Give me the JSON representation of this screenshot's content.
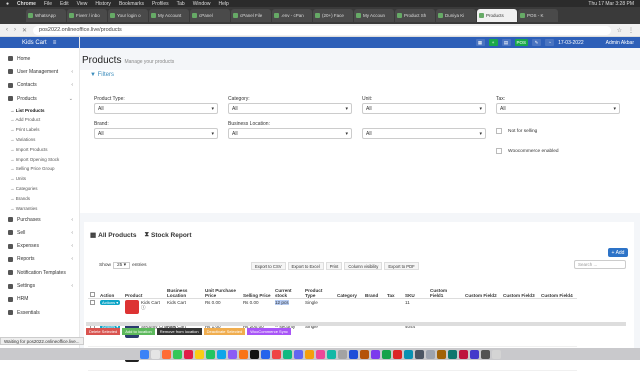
{
  "macos_menu": {
    "apple": "",
    "items": [
      "Chrome",
      "File",
      "Edit",
      "View",
      "History",
      "Bookmarks",
      "Profiles",
      "Tab",
      "Window",
      "Help"
    ],
    "clock": "Thu 17 Mar 3:28 PM"
  },
  "browser": {
    "tabs": [
      {
        "label": "WhatsApp",
        "active": false
      },
      {
        "label": "Fiverr / inbo",
        "active": false
      },
      {
        "label": "Your login o",
        "active": false
      },
      {
        "label": "My Account",
        "active": false
      },
      {
        "label": "cPanel",
        "active": false
      },
      {
        "label": "cPanel File",
        "active": false
      },
      {
        "label": ".env - cPan",
        "active": false
      },
      {
        "label": "(20+) Face",
        "active": false
      },
      {
        "label": "My Accoun",
        "active": false
      },
      {
        "label": "Product Sh",
        "active": false
      },
      {
        "label": "Duniya Ki",
        "active": false
      },
      {
        "label": "Products",
        "active": true
      },
      {
        "label": "POS - K",
        "active": false
      }
    ],
    "url": "pos2022.onlineoffice.live/products"
  },
  "app": {
    "brand": "Kids Cart",
    "topbar": {
      "pos_label": "POS",
      "date": "17-03-2022",
      "user": "Admin Akbar"
    }
  },
  "sidebar": {
    "items": [
      {
        "label": "Home",
        "chevron": ""
      },
      {
        "label": "User Management",
        "chevron": "‹"
      },
      {
        "label": "Contacts",
        "chevron": "‹"
      },
      {
        "label": "Products",
        "chevron": "⌄"
      }
    ],
    "subitems": [
      {
        "label": "→ List Products",
        "active": true
      },
      {
        "label": "→ Add Product",
        "active": false
      },
      {
        "label": "→ Print Labels",
        "active": false
      },
      {
        "label": "→ Variations",
        "active": false
      },
      {
        "label": "→ Import Products",
        "active": false
      },
      {
        "label": "→ Import Opening Stock",
        "active": false
      },
      {
        "label": "→ Selling Price Group",
        "active": false
      },
      {
        "label": "→ Units",
        "active": false
      },
      {
        "label": "→ Categories",
        "active": false
      },
      {
        "label": "→ Brands",
        "active": false
      },
      {
        "label": "→ Warranties",
        "active": false
      }
    ],
    "items2": [
      {
        "label": "Purchases",
        "chevron": "‹"
      },
      {
        "label": "Sell",
        "chevron": "‹"
      },
      {
        "label": "Expenses",
        "chevron": "‹"
      },
      {
        "label": "Reports",
        "chevron": "‹"
      },
      {
        "label": "Notification Templates",
        "chevron": ""
      },
      {
        "label": "Settings",
        "chevron": "‹"
      },
      {
        "label": "HRM",
        "chevron": ""
      },
      {
        "label": "Essentials",
        "chevron": ""
      }
    ]
  },
  "page": {
    "title": "Products",
    "subtitle": "Manage your products",
    "filters_heading": "Filters",
    "filters": {
      "product_type": {
        "label": "Product Type:",
        "value": "All"
      },
      "category": {
        "label": "Category:",
        "value": "All"
      },
      "unit": {
        "label": "Unit:",
        "value": "All"
      },
      "tax": {
        "label": "Tax:",
        "value": "All"
      },
      "brand": {
        "label": "Brand:",
        "value": "All"
      },
      "business_location": {
        "label": "Business Location:",
        "value": "All"
      },
      "unnamed": {
        "label": "",
        "value": "All"
      },
      "not_for_selling": "Not for selling",
      "woocommerce_enabled": "Woocommerce enabled"
    },
    "tabs": {
      "all_products": "All Products",
      "stock_report": "Stock Report"
    },
    "add_button": "+ Add",
    "show": {
      "before": "Show",
      "value": "25",
      "after": "entries"
    },
    "exports": [
      "Export to CSV",
      "Export to Excel",
      "Print",
      "Column visibility",
      "Export to PDF"
    ],
    "search_placeholder": "Search ...",
    "columns": [
      "Action",
      "Product",
      "Business Location",
      "Unit Purchase Price",
      "Selling Price",
      "Current stock",
      "Product Type",
      "Category",
      "Brand",
      "Tax",
      "SKU",
      "Custom Field1",
      "Custom Field2",
      "Custom Field3",
      "Custom Field4"
    ],
    "rows": [
      {
        "action": "Actions",
        "product": "Kids Cart",
        "location": "Kids Cart",
        "purchase": "₨ 0.00",
        "selling": "₨ 0.00",
        "stock": "12 pcs",
        "type": "Single",
        "category": "",
        "brand": "",
        "tax": "",
        "sku": "11",
        "img": "#d33"
      },
      {
        "action": "Actions",
        "product": "Security Charges",
        "location": "Kids Cart",
        "purchase": "₨ 1.00",
        "selling": "₨ 200.00",
        "stock": "-- security",
        "type": "Single",
        "category": "",
        "brand": "",
        "tax": "",
        "sku": "4044",
        "img": "#2a3b6e"
      },
      {
        "action": "Actions",
        "product": "service Fee",
        "location": "Kids Cart",
        "purchase": "₨ 1.00",
        "selling": "₨ 300.00",
        "stock": "-- rent",
        "type": "Single",
        "category": "",
        "brand": "",
        "tax": "",
        "sku": "4045",
        "img": "#222"
      }
    ],
    "bulk_actions": [
      {
        "label": "Delete Selected",
        "color": "#d9534f"
      },
      {
        "label": "Add to location",
        "color": "#5cb85c"
      },
      {
        "label": "Remove from location",
        "color": "#333"
      },
      {
        "label": "Deactivate Selected",
        "color": "#f0ad4e"
      },
      {
        "label": "WooCommerce Sync",
        "color": "#a855f7"
      }
    ]
  },
  "status_bar": "Waiting for pos2022.onlineoffice.live..."
}
